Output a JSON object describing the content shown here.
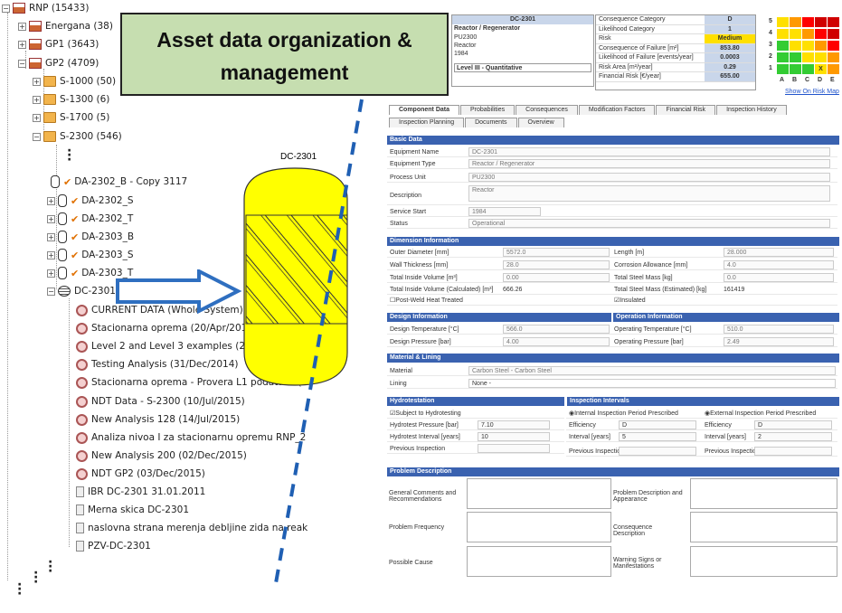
{
  "tree": {
    "root": "RNP (15433)",
    "n1": "Energana (38)",
    "n2": "GP1 (3643)",
    "n3": "GP2 (4709)",
    "s1000": "S-1000 (50)",
    "s1300": "S-1300 (6)",
    "s1700": "S-1700 (5)",
    "s2300": "S-2300 (546)",
    "da1": "DA-2302_B - Copy 3117",
    "da2": "DA-2302_S",
    "da3": "DA-2302_T",
    "da4": "DA-2303_B",
    "da5": "DA-2303_S",
    "da6": "DA-2303_T",
    "dc": "DC-2301",
    "a1": "CURRENT DATA (Whole System)",
    "a2": "Stacionarna oprema (20/Apr/2015)",
    "a3": "Level 2 and Level 3 examples (20/A",
    "a4": "Testing Analysis (31/Dec/2014)",
    "a5": "Stacionarna oprema - Provera L1 podataka (",
    "a6": "NDT Data - S-2300 (10/Jul/2015)",
    "a7": "New Analysis 128 (14/Jul/2015)",
    "a8": "Analiza nivoa I za stacionarnu opremu RNP_2",
    "a9": "New Analysis 200 (02/Dec/2015)",
    "a10": "NDT GP2 (03/Dec/2015)",
    "d1": "IBR DC-2301 31.01.2011",
    "d2": "Merna skica DC-2301",
    "d3": "naslovna strana merenja debljine zida na reak",
    "d4": "PZV-DC-2301"
  },
  "overlay": {
    "title_l1": "Asset data organization &",
    "title_l2": "management",
    "vessel_label": "DC-2301"
  },
  "panel": {
    "header": {
      "tag": "DC-2301",
      "type": "Reactor / Regenerator",
      "unit": "PU2300",
      "desc": "Reactor",
      "year": "1984",
      "level": "Level III - Quantitative"
    },
    "risk": [
      {
        "label": "Consequence Category",
        "value": "D"
      },
      {
        "label": "Likelihood Category",
        "value": "1"
      },
      {
        "label": "Risk",
        "value": "Medium"
      },
      {
        "label": "Consequence of Failure [m²]",
        "value": "853.80"
      },
      {
        "label": "Likelihood of Failure [events/year]",
        "value": "0.0003"
      },
      {
        "label": "Risk Area [m²/year]",
        "value": "0.29"
      },
      {
        "label": "Financial Risk [€/year]",
        "value": "655.00"
      }
    ],
    "matrix_link": "Show On Risk Map",
    "matrix_rows": [
      "5",
      "4",
      "3",
      "2",
      "1"
    ],
    "matrix_cols": [
      "A",
      "B",
      "C",
      "D",
      "E"
    ],
    "matrix_mark": "X",
    "tabs1": [
      "Component Data",
      "Probabilities",
      "Consequences",
      "Modification Factors",
      "Financial Risk",
      "Inspection History"
    ],
    "tabs2": [
      "Inspection Planning",
      "Documents",
      "Overview"
    ],
    "basic": {
      "title": "Basic Data",
      "f1": "Equipment Name",
      "v1": "DC-2301",
      "f2": "Equipment Type",
      "v2": "Reactor / Regenerator",
      "f3": "Process Unit",
      "v3": "PU2300",
      "f4": "Description",
      "v4": "Reactor",
      "f5": "Service Start",
      "v5": "1984",
      "f6": "Status",
      "v6": "Operational"
    },
    "dim": {
      "title": "Dimension Information",
      "od": "Outer Diameter [mm]",
      "odv": "5572.0",
      "len": "Length [m]",
      "lenv": "28.000",
      "wt": "Wall Thickness [mm]",
      "wtv": "28.0",
      "ca": "Corrosion Allowance [mm]",
      "cav": "4.0",
      "tiv": "Total Inside Volume [m³]",
      "tivv": "0.00",
      "tsm": "Total Steel Mass [kg]",
      "tsmv": "0.0",
      "tivc": "Total Inside Volume (Calculated) [m³]",
      "tivcv": "666.26",
      "tsme": "Total Steel Mass (Estimated) [kg]",
      "tsmev": "161419",
      "pwht": "Post-Weld Heat Treated",
      "ins": "Insulated"
    },
    "design": {
      "title": "Design Information",
      "dt": "Design Temperature [°C]",
      "dtv": "566.0",
      "dp": "Design Pressure [bar]",
      "dpv": "4.00"
    },
    "oper": {
      "title": "Operation Information",
      "ot": "Operating Temperature [°C]",
      "otv": "510.0",
      "op": "Operating Pressure [bar]",
      "opv": "2.49"
    },
    "mat": {
      "title": "Material & Lining",
      "m": "Material",
      "mv": "Carbon Steel - Carbon Steel",
      "l": "Lining",
      "lv": "None -"
    },
    "hydro": {
      "title": "Hydrotestation",
      "sub": "Subject to Hydrotesting",
      "hp": "Hydrotest Pressure [bar]",
      "hpv": "7.10",
      "hi": "Hydrotest Interval [years]",
      "hiv": "10",
      "pi": "Previous Inspection"
    },
    "intv": {
      "title": "Inspection Intervals",
      "int": "Internal Inspection Period Prescribed",
      "ext": "External Inspection Period Prescribed",
      "eff": "Efficiency",
      "effv": "D",
      "iy": "Interval [years]",
      "iyv1": "5",
      "iyv2": "2",
      "pi": "Previous Inspection"
    },
    "prob": {
      "title": "Problem Description",
      "g": "General Comments and Recommendations",
      "pda": "Problem Description and Appearance",
      "pf": "Problem Frequency",
      "cd": "Consequence Description",
      "pc": "Possible Cause",
      "ws": "Warning Signs or Manifestations"
    }
  }
}
